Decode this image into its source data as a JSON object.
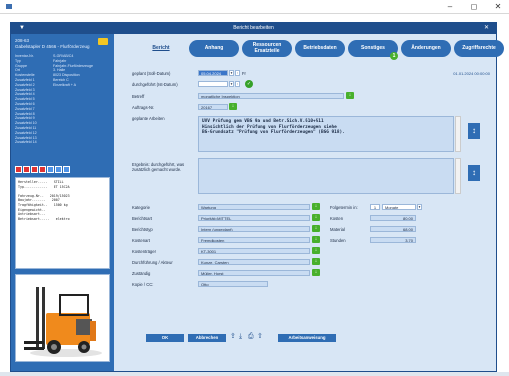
{
  "window": {
    "title": "Bericht bearbeiten",
    "collapse_icon": "chevron-down-icon",
    "close_label": "✕"
  },
  "os": {
    "minimize": "–",
    "maximize": "◻",
    "close": "✕"
  },
  "left_panel": {
    "object_id": "208-63",
    "object_name": "Gabelstapler D 4566 - Flurförderzeug",
    "properties": [
      {
        "k": "Inventar-Nr.",
        "v": "S-GR/AB/C4"
      },
      {
        "k": "Typ",
        "v": "Fahrjahr"
      },
      {
        "k": "Gruppe",
        "v": "Fahrjahr-Flurförderzeuge"
      },
      {
        "k": "Ort",
        "v": "3. Halle"
      },
      {
        "k": "Kostenstelle",
        "v": "8023 Disposition"
      },
      {
        "k": "Zusatzfeld 1",
        "v": "Bereich C"
      },
      {
        "k": "Zusatzfeld 2",
        "v": "Einzelkraft + A"
      },
      {
        "k": "Zusatzfeld 3",
        "v": ""
      },
      {
        "k": "Zusatzfeld 4",
        "v": ""
      },
      {
        "k": "Zusatzfeld 5",
        "v": ""
      },
      {
        "k": "Zusatzfeld 6",
        "v": ""
      },
      {
        "k": "Zusatzfeld 7",
        "v": ""
      },
      {
        "k": "Zusatzfeld 8",
        "v": ""
      },
      {
        "k": "Zusatzfeld 9",
        "v": ""
      },
      {
        "k": "Zusatzfeld 10",
        "v": ""
      },
      {
        "k": "Zusatzfeld 11",
        "v": ""
      },
      {
        "k": "Zusatzfeld 12",
        "v": ""
      },
      {
        "k": "Zusatzfeld 13",
        "v": ""
      },
      {
        "k": "Zusatzfeld 14",
        "v": ""
      }
    ],
    "details_text": "Hersteller.....   STILL\nTyp............   ET 15C2A\n\nFahrzeug-Nr..   2019/15023\nBaujahr.......   2007\nTragfähigkeit..   1500 kg\nEigengewicht..\nAntriebsart...\nBetriebsart.....   elektro"
  },
  "tabs": [
    {
      "label": "Bericht",
      "active": true
    },
    {
      "label": "Anhang",
      "active": false
    },
    {
      "label": "Ressourcen Ersatzteile",
      "active": false
    },
    {
      "label": "Betriebsdaten",
      "active": false
    },
    {
      "label": "Sonstiges",
      "active": false,
      "badge": "1"
    },
    {
      "label": "Änderungen",
      "active": false
    },
    {
      "label": "Zugriffsrechte",
      "active": false
    }
  ],
  "form": {
    "created_date": "01.01.2024 00:00:00",
    "geplant_label": "geplant (Soll-Datum)",
    "geplant_value": "05.04.2024",
    "geplant_suffix": "Fr",
    "durchgefuehrt_label": "durchgeführt (Ist-Datum)",
    "durchgefuehrt_value": "",
    "betreff_label": "Betreff",
    "betreff_value": "monatliche Inspektion",
    "auftrags_label": "Auftrags-Nr.",
    "auftrags_value": "20167",
    "geplante_arbeiten_label": "geplante Arbeiten",
    "geplante_arbeiten_text": "UVV Prüfung gem VBG 9a und Betr.Sich.V.§10+§11\nHinsichtlich der Prüfung von Flurförderzeugen siehe\nBG-Grundsatz \"Prüfung von Flurförderzeugen\" (BGG 918).",
    "ergebnis_label": "Ergebnis: durchgeführt, was zusätzlich gemacht wurde.",
    "ergebnis_text": "",
    "kategorie_label": "Kategorie",
    "kategorie_value": "Wartung",
    "berichtsart_label": "Berichtsart",
    "berichtsart_value": "Priorität=MITTEL",
    "berichtstyp_label": "Berichtstyp",
    "berichtstyp_value": "Intern (ungeplant)",
    "kostenart_label": "Kostenart",
    "kostenart_value": "Fremdkosten",
    "kostentraeger_label": "Kostenträger",
    "kostentraeger_value": "KT-3001",
    "durchfuehrung_label": "Durchführung / Akteur",
    "durchfuehrung_value": "Kunze, Carsten",
    "zustaendig_label": "Zuständig",
    "zustaendig_value": "Müller, Horst",
    "kopie_label": "Kopie / CC:",
    "kopie_value": "Otto",
    "folgetermin_label": "Folgetermin in:",
    "folgetermin_value": "1",
    "folgetermin_unit": "Monate",
    "kosten_label": "Kosten",
    "kosten_value": "80,00",
    "material_label": "Material",
    "material_value": "68,00",
    "stunden_label": "Stunden",
    "stunden_value": "3,70"
  },
  "buttons": {
    "ok": "OK",
    "abbrechen": "Abbrechen",
    "arbeitsanweisung": "Arbeitsanweisung"
  },
  "colors": {
    "accent": "#2f6db4",
    "window_border": "#1f4e8c",
    "field": "#c9dcf2",
    "green": "#48b02c"
  }
}
